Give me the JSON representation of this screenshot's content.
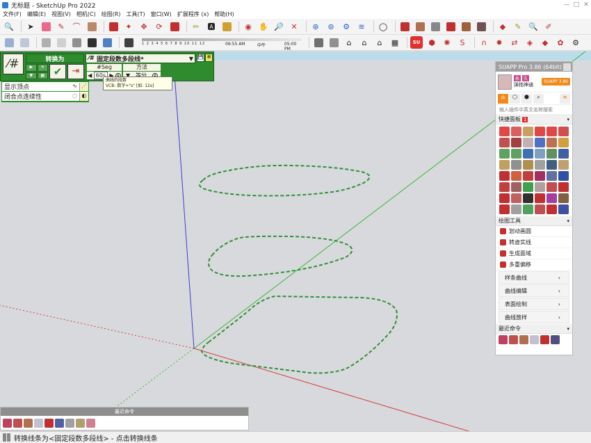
{
  "window": {
    "title": "无标题 - SketchUp Pro 2022",
    "minimize": "—",
    "maximize": "□",
    "close": "✕"
  },
  "menu": [
    "文件(F)",
    "编辑(E)",
    "视图(V)",
    "相机(C)",
    "绘图(R)",
    "工具(T)",
    "窗口(W)",
    "扩展程序 (x)",
    "帮助(H)"
  ],
  "shadow": {
    "months": "1 2 3 4 5 6 7 8 9 10 11 12",
    "time_start": "06:55 AM",
    "noon": "中午",
    "time_end": "05:00 PM"
  },
  "plugin_toolbar": {
    "convert_title": "转换为",
    "mode": "固定段数多段线*",
    "seg_header": "#Seg",
    "method_header": "方法",
    "seg_value": "60s",
    "method_value": "等分",
    "auto_flag": "A"
  },
  "tooltip": {
    "title": "曲线的段数",
    "hint": "VCB: 数字+\"s\" [如: 12s]"
  },
  "options": {
    "show_vertices": "显示顶点",
    "closure_continuity": "闭合点连续性"
  },
  "suapp": {
    "title": "SUAPP Pro 3.86 (64bit)",
    "user_badges": [
      "永",
      "久"
    ],
    "user_name": "弹指神通",
    "version_badge": "SUAPP 3.86",
    "search_placeholder": "输入插件中英文名称搜索",
    "quick_panel": "快捷面板",
    "quick_panel_count": "1",
    "drawing_tools": "绘图工具",
    "tool_items": [
      "划动画圆",
      "转虚实线",
      "生成面域",
      "多重偏移"
    ],
    "categories": [
      "样条曲线",
      "曲线编辑",
      "表面绘制",
      "曲线放样"
    ],
    "recent": "最近命令"
  },
  "recent_panel": {
    "title": "最近命令"
  },
  "status": {
    "text": "转换线条为<固定段数多段线> - 点击转换线条"
  },
  "colors": {
    "plugin_green": "#2e8b2e",
    "suapp_orange": "#f08a1c",
    "axis_red": "#d23c3c",
    "axis_green": "#3cb43c",
    "axis_blue": "#3c3ccc",
    "dash_green": "#2f8f3a"
  },
  "icons": {
    "toolbar_row1": [
      "search-icon",
      "select-arrow-icon",
      "eraser-icon",
      "pencil-icon",
      "arc-icon",
      "rectangle-icon",
      "pushpull-icon",
      "follow-me-icon",
      "move-icon",
      "rotate-icon",
      "scale-icon",
      "tape-icon",
      "text-icon",
      "paint-icon",
      "orbit-icon",
      "pan-icon",
      "zoom-icon",
      "zoom-extents-icon",
      "warehouse-icon",
      "extension-icon",
      "layers-icon",
      "model-info-icon",
      "user-icon"
    ],
    "toolbar_row2": [
      "iso-view-icon",
      "top-view-icon",
      "front-view-icon",
      "right-view-icon",
      "back-view-icon",
      "left-view-icon",
      "xray-icon",
      "shadow-icon",
      "sandbox-icon",
      "house-icon",
      "components-icon"
    ]
  }
}
